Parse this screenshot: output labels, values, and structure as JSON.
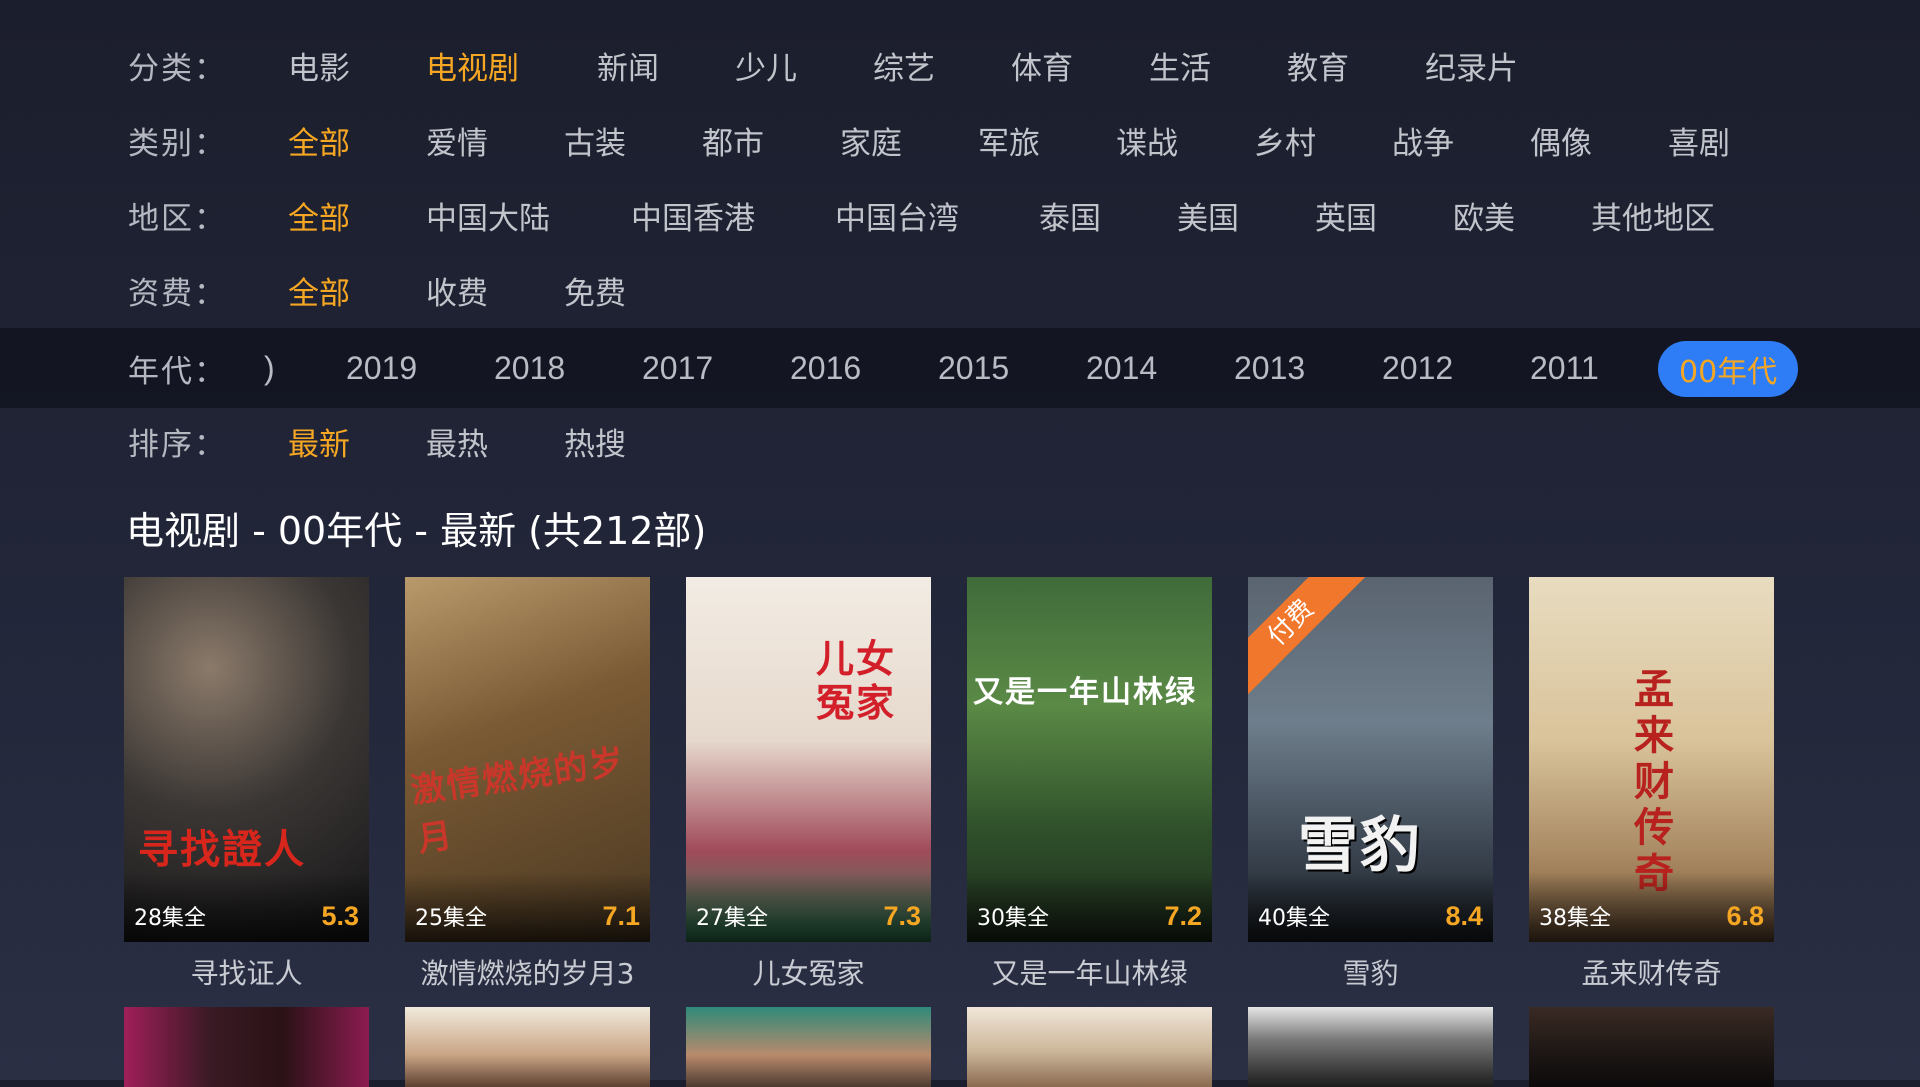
{
  "filters": {
    "category": {
      "label": "分类：",
      "options": [
        "电影",
        "电视剧",
        "新闻",
        "少儿",
        "综艺",
        "体育",
        "生活",
        "教育",
        "纪录片"
      ],
      "selected": "电视剧"
    },
    "genre": {
      "label": "类别：",
      "options": [
        "全部",
        "爱情",
        "古装",
        "都市",
        "家庭",
        "军旅",
        "谍战",
        "乡村",
        "战争",
        "偶像",
        "喜剧"
      ],
      "selected": "全部"
    },
    "region": {
      "label": "地区：",
      "options": [
        "全部",
        "中国大陆",
        "中国香港",
        "中国台湾",
        "泰国",
        "美国",
        "英国",
        "欧美",
        "其他地区"
      ],
      "selected": "全部"
    },
    "fee": {
      "label": "资费：",
      "options": [
        "全部",
        "收费",
        "免费"
      ],
      "selected": "全部"
    },
    "era": {
      "label": "年代：",
      "options": [
        ")",
        "2019",
        "2018",
        "2017",
        "2016",
        "2015",
        "2014",
        "2013",
        "2012",
        "2011",
        "00年代"
      ],
      "selected": "00年代"
    },
    "sort": {
      "label": "排序：",
      "options": [
        "最新",
        "最热",
        "热搜"
      ],
      "selected": "最新"
    }
  },
  "results_heading": "电视剧 - 00年代 - 最新 (共212部)",
  "colors": {
    "accent": "#f5a623",
    "pill": "#2e7df6",
    "paid_ribbon": "#f0772b"
  },
  "paid_label": "付费",
  "cards": [
    {
      "title": "寻找证人",
      "episodes": "28集全",
      "score": "5.3",
      "paid": false,
      "poster_text": "寻找證人"
    },
    {
      "title": "激情燃烧的岁月3",
      "episodes": "25集全",
      "score": "7.1",
      "paid": false,
      "poster_text": "激情燃烧的岁月"
    },
    {
      "title": "儿女冤家",
      "episodes": "27集全",
      "score": "7.3",
      "paid": false,
      "poster_text": "儿女冤家"
    },
    {
      "title": "又是一年山林绿",
      "episodes": "30集全",
      "score": "7.2",
      "paid": false,
      "poster_text": "又是一年山林绿"
    },
    {
      "title": "雪豹",
      "episodes": "40集全",
      "score": "8.4",
      "paid": true,
      "poster_text": "雪豹"
    },
    {
      "title": "孟来财传奇",
      "episodes": "38集全",
      "score": "6.8",
      "paid": false,
      "poster_text": "孟来财传奇"
    }
  ]
}
